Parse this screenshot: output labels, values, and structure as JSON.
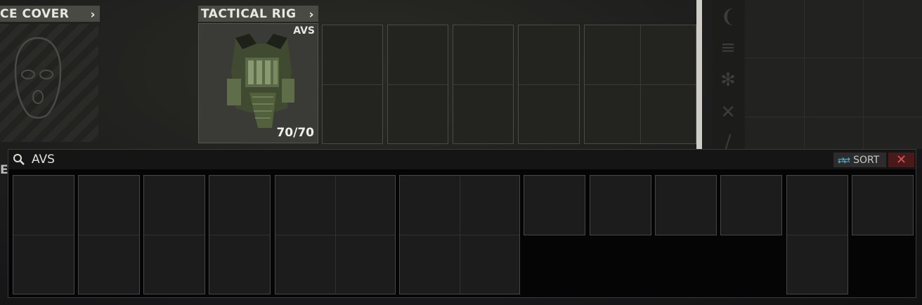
{
  "face_cover": {
    "title": "CE COVER",
    "chevron": "›"
  },
  "tactical_rig": {
    "title": "TACTICAL RIG",
    "chevron": "›",
    "item_name": "AVS",
    "durability": "70/70"
  },
  "side_letter": "E",
  "side_icons": [
    "magazine-icon",
    "ammo-icon",
    "medical-icon",
    "food-icon",
    "knife-icon"
  ],
  "search_window": {
    "query": "AVS",
    "sort_label": "SORT",
    "close_label": "✕"
  },
  "colors": {
    "header_bg": "#4a4a44",
    "close_bg": "#4a1a1a",
    "close_fg": "#e05050",
    "sort_icon": "#6ab0c8"
  }
}
